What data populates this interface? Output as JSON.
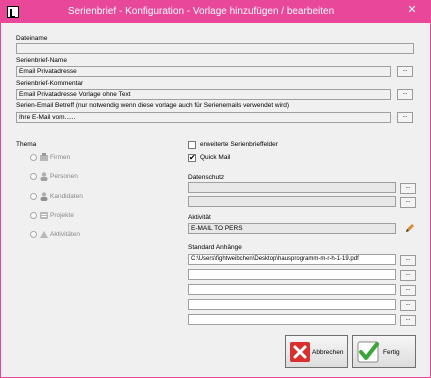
{
  "window": {
    "title": "Serienbrief - Konfiguration - Vorlage hinzufügen / bearbeiten",
    "close_glyph": "✕"
  },
  "fields": {
    "dateiname_label": "Dateiname",
    "dateiname_value": "",
    "name_label": "Serienbrief-Name",
    "name_value": "Email Privatadresse",
    "kommentar_label": "Serienbrief-Kommentar",
    "kommentar_value": "Email Privatadresse Vorlage ohne Text",
    "betreff_label": "Serien-Email Betreff (nur notwendig wenn diese vorlage auch für Serienemails verwendet wird)",
    "betreff_value": "Ihre E-Mail vom......"
  },
  "browse_glyph": "...",
  "thema": {
    "label": "Thema",
    "options": [
      {
        "label": "Firmen"
      },
      {
        "label": "Personen"
      },
      {
        "label": "Kandidaten"
      },
      {
        "label": "Projekte"
      },
      {
        "label": "Aktivitäten"
      }
    ]
  },
  "options": {
    "erweiterte_label": "erweiterte Serienbrieffelder",
    "erweiterte_checked": false,
    "quickmail_label": "Quick Mail",
    "quickmail_checked": true,
    "check_glyph": "✔"
  },
  "datenschutz": {
    "label": "Datenschutz"
  },
  "aktivitaet": {
    "label": "Aktivität",
    "value": "E-MAIL TO PERS"
  },
  "anhaenge": {
    "label": "Standard Anhänge",
    "items": [
      "C:\\Users\\fightweibchen\\Desktop\\hausprogramm-m-r-h-1-19.pdf",
      "",
      "",
      "",
      ""
    ]
  },
  "buttons": {
    "cancel": "Abbrechen",
    "ok": "Fertig"
  },
  "colors": {
    "title_bar": "#e8479a",
    "cancel_icon": "#d9302f",
    "ok_icon": "#3aa63a"
  }
}
